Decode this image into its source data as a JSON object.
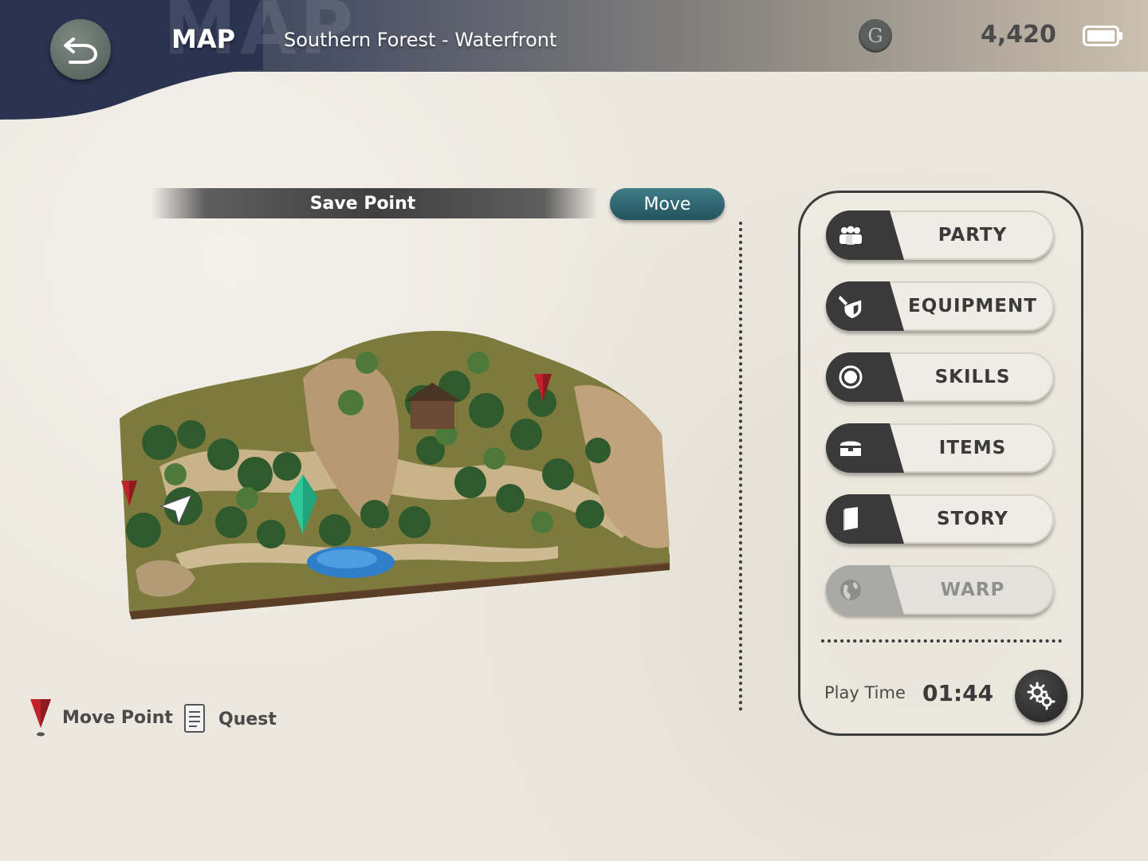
{
  "header": {
    "watermark": "MAP",
    "title": "MAP",
    "location": "Southern Forest - Waterfront",
    "currency_icon": "G",
    "gold": "4,420",
    "battery_icon": "battery-icon"
  },
  "map_area": {
    "save_point_label": "Save Point",
    "move_button_label": "Move",
    "markers": [
      "move-point-marker",
      "move-point-marker",
      "player-arrow-marker",
      "save-crystal"
    ]
  },
  "legend": {
    "move_point_label": "Move Point",
    "quest_label": "Quest"
  },
  "menu": {
    "items": [
      {
        "label": "PARTY",
        "icon": "party-icon",
        "enabled": true
      },
      {
        "label": "EQUIPMENT",
        "icon": "equipment-icon",
        "enabled": true
      },
      {
        "label": "SKILLS",
        "icon": "skills-icon",
        "enabled": true
      },
      {
        "label": "ITEMS",
        "icon": "items-icon",
        "enabled": true
      },
      {
        "label": "STORY",
        "icon": "story-icon",
        "enabled": true
      },
      {
        "label": "WARP",
        "icon": "globe-icon",
        "enabled": false
      }
    ]
  },
  "footer": {
    "play_time_label": "Play Time",
    "play_time_value": "01:44",
    "settings_icon": "gears-icon"
  },
  "colors": {
    "header_dark": "#2a3350",
    "move_button": "#2f6a74",
    "marker_red": "#c0242a",
    "crystal": "#2fc79a",
    "menu_dark": "#3a3a3a"
  }
}
